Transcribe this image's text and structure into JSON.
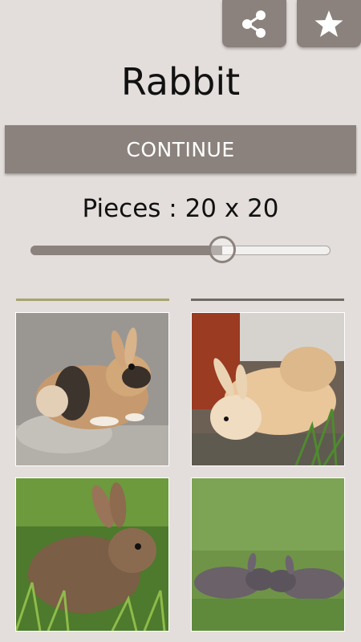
{
  "header": {
    "share_icon": "share-icon",
    "favorite_icon": "star-icon"
  },
  "title": "Rabbit",
  "continue_label": "CONTINUE",
  "pieces": {
    "label": "Pieces : 20 x 20",
    "slider_fraction": 0.64
  },
  "colors": {
    "accent": "#8b827d",
    "background": "#e3dedb"
  },
  "gallery": [
    {
      "subject": "calico rabbit on concrete"
    },
    {
      "subject": "cream rabbit near pot and grass"
    },
    {
      "subject": "wild cottontail in grass"
    },
    {
      "subject": "two rabbits on lawn"
    }
  ]
}
